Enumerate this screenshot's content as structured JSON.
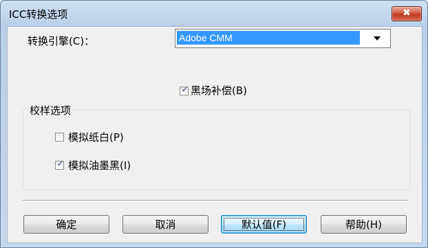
{
  "window": {
    "title": "ICC转换选项"
  },
  "titlebar": {
    "close_glyph": "✖",
    "close_icon": "close-icon"
  },
  "engine": {
    "label": "转换引擎(C)：",
    "selected": "Adobe CMM",
    "dropdown_icon": "chevron-down-icon"
  },
  "black_point": {
    "label": "黑场补偿(B)",
    "checked": true
  },
  "proof": {
    "title": "校样选项",
    "simulate_paper": {
      "label": "模拟纸白(P)",
      "checked": false
    },
    "simulate_ink": {
      "label": "模拟油墨黑(I)",
      "checked": true
    }
  },
  "buttons": {
    "ok": "确定",
    "cancel": "取消",
    "default": "默认值(F)",
    "help": "帮助(H)"
  },
  "check_glyph": "✓"
}
